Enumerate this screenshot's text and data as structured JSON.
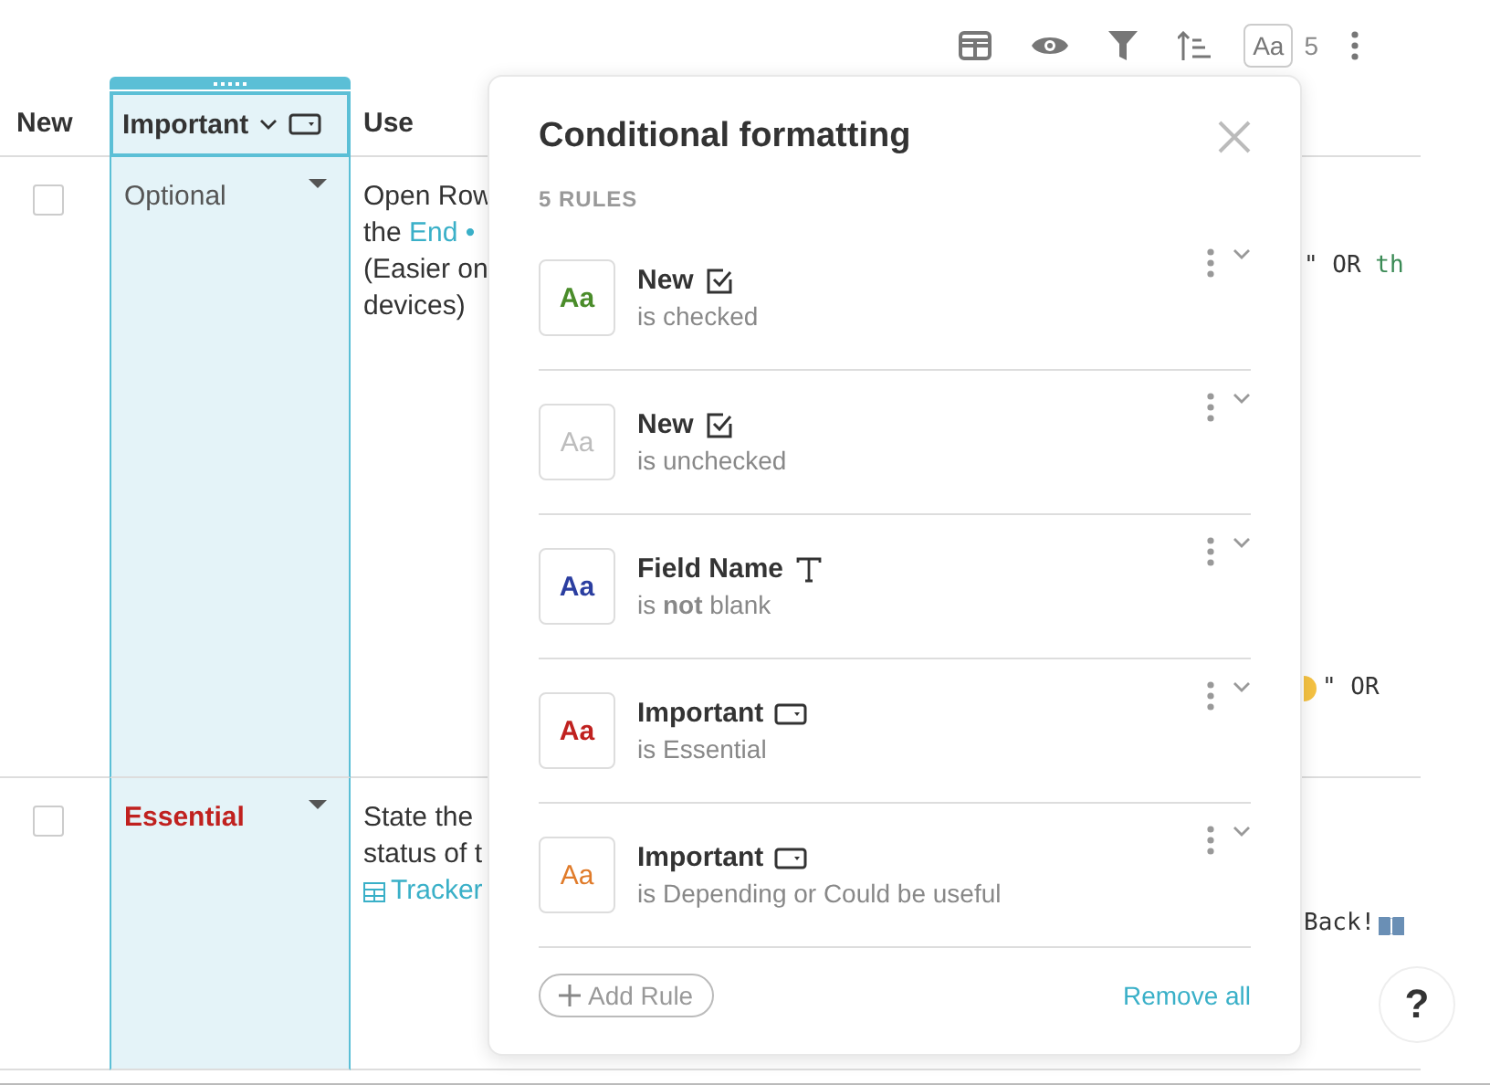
{
  "toolbar": {
    "format_count": "5",
    "format_label": "Aa"
  },
  "table": {
    "columns": [
      {
        "label": "New",
        "selected": false
      },
      {
        "label": "Important",
        "selected": true
      },
      {
        "label": "Use",
        "selected": false
      }
    ],
    "rows": [
      {
        "new": {
          "checked": false
        },
        "important": {
          "value": "Optional",
          "color": "#555555",
          "bold": false
        },
        "use": [
          [
            {
              "text": "Open Row"
            }
          ],
          [
            {
              "text": "the "
            },
            {
              "text": "End •",
              "link": true
            }
          ],
          [
            {
              "text": "(Easier on"
            }
          ],
          [
            {
              "text": "devices)"
            }
          ]
        ],
        "column_4": [
          {
            "parts": [
              {
                "text": "\" OR "
              },
              {
                "text": "th",
                "green": true
              }
            ]
          },
          {
            "emoji": true,
            "parts": [
              {
                "text": "\" OR"
              }
            ]
          }
        ]
      },
      {
        "new": {
          "checked": false
        },
        "important": {
          "value": "Essential",
          "color": "#c0211f",
          "bold": true
        },
        "use": [
          [
            {
              "text": "State the"
            }
          ],
          [
            {
              "text": "status of t"
            }
          ],
          [
            {
              "text": "Tracker",
              "link": true,
              "table_icon": true
            }
          ]
        ],
        "column_4": [
          {
            "book": true,
            "parts": [
              {
                "text": "Back!"
              }
            ]
          }
        ]
      }
    ]
  },
  "popover": {
    "title": "Conditional formatting",
    "count_label": "5 RULES",
    "rules": [
      {
        "swatch": "Aa",
        "field": "New",
        "kind": "checkbox",
        "condition": "is checked",
        "color": "#4a8c2a",
        "bold": true
      },
      {
        "swatch": "Aa",
        "field": "New",
        "kind": "checkbox",
        "condition": "is unchecked",
        "color": "#bdbdbd",
        "bold": false
      },
      {
        "swatch": "Aa",
        "field": "Field Name",
        "kind": "text",
        "condition": "is **not** blank",
        "color": "#2b3ea0",
        "bold": true
      },
      {
        "swatch": "Aa",
        "field": "Important",
        "kind": "select",
        "condition": "is Essential",
        "color": "#c0211f",
        "bold": true
      },
      {
        "swatch": "Aa",
        "field": "Important",
        "kind": "select",
        "condition": "is Depending or Could be useful",
        "color": "#e07b2a",
        "bold": false
      }
    ],
    "add_label": "Add Rule",
    "remove_label": "Remove all"
  },
  "help_label": "?"
}
